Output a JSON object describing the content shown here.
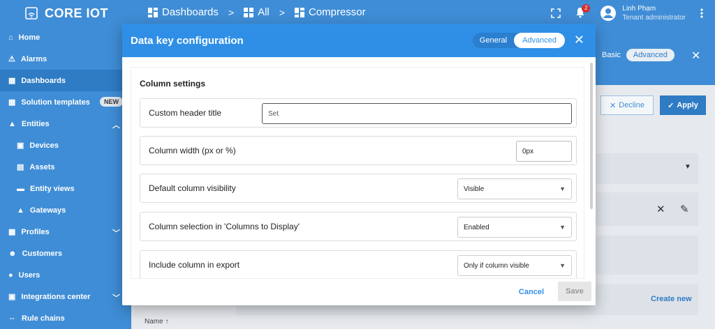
{
  "app": {
    "logo_text": "CORE IOT",
    "breadcrumb": [
      "Dashboards",
      "All",
      "Compressor"
    ],
    "notifications_count": "2",
    "user_name": "Linh Phạm",
    "user_role": "Tenant administrator"
  },
  "sidebar": {
    "items": [
      {
        "label": "Home",
        "icon": "home-icon"
      },
      {
        "label": "Alarms",
        "icon": "warning-icon"
      },
      {
        "label": "Dashboards",
        "icon": "dashboard-icon"
      },
      {
        "label": "Solution templates",
        "icon": "grid-icon",
        "badge": "NEW"
      },
      {
        "label": "Entities",
        "icon": "entities-icon"
      },
      {
        "label": "Devices",
        "icon": "devices-icon"
      },
      {
        "label": "Assets",
        "icon": "assets-icon"
      },
      {
        "label": "Entity views",
        "icon": "entity-views-icon"
      },
      {
        "label": "Gateways",
        "icon": "gateways-icon"
      },
      {
        "label": "Profiles",
        "icon": "profiles-icon"
      },
      {
        "label": "Customers",
        "icon": "customers-icon"
      },
      {
        "label": "Users",
        "icon": "users-icon"
      },
      {
        "label": "Integrations center",
        "icon": "integrations-icon"
      },
      {
        "label": "Rule chains",
        "icon": "rule-chains-icon"
      }
    ]
  },
  "background": {
    "tab_basic": "Basic",
    "tab_advanced": "Advanced",
    "decline_label": "Decline",
    "apply_label": "Apply",
    "create_new_label": "Create new",
    "name_column": "Name"
  },
  "dialog": {
    "title": "Data key configuration",
    "tab_general": "General",
    "tab_advanced": "Advanced",
    "section_title": "Column settings",
    "rows": {
      "header_title": {
        "label": "Custom header title",
        "placeholder": "Set"
      },
      "column_width": {
        "label": "Column width (px or %)",
        "value": "0px"
      },
      "default_visibility": {
        "label": "Default column visibility",
        "value": "Visible"
      },
      "columns_to_display": {
        "label": "Column selection in 'Columns to Display'",
        "value": "Enabled"
      },
      "include_export": {
        "label": "Include column in export",
        "value": "Only if column visible"
      }
    },
    "cancel_label": "Cancel",
    "save_label": "Save"
  }
}
